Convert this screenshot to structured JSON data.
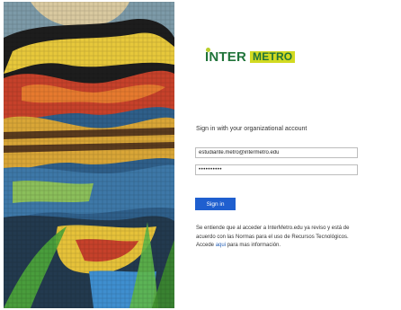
{
  "brand": {
    "logo_text_part1": "INTER",
    "logo_text_part2": "METRO",
    "brand_green": "#21743a",
    "brand_yellow": "#d2da21"
  },
  "mosaic_image": {
    "icon": "colorful-mosaic-artwork"
  },
  "login": {
    "heading": "Sign in with your organizational account",
    "email_value": "estudiante.metro@intermetro.edu",
    "password_value": "••••••••••",
    "signin_button": "Sign in",
    "button_color": "#1f5fcf",
    "notice_part1": "Se entiende que al acceder a InterMetro.edu ya reviso y está de acuerdo con las Normas para el uso de Recursos Tecnológicos. Accede",
    "notice_link": "aqui",
    "notice_part2": "para mas información."
  }
}
